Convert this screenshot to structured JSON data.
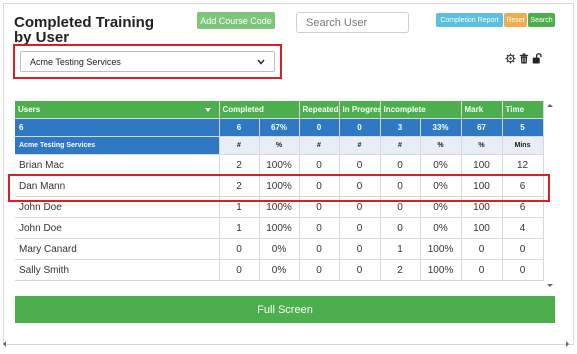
{
  "title": {
    "line1": "Completed Training",
    "line2": "by User"
  },
  "toolbar": {
    "add_course_code": "Add Course Code",
    "completion_report": "Completion Report",
    "reset": "Reset",
    "search": "Search"
  },
  "search": {
    "placeholder": "Search User"
  },
  "select": {
    "value": "Acme Testing Services"
  },
  "icons": [
    "gear-icon",
    "trash-icon",
    "unlock-icon",
    "chevron-down-icon",
    "sort-icon",
    "scroll-up-icon",
    "scroll-down-icon",
    "scroll-left-icon",
    "scroll-right-icon"
  ],
  "colors": {
    "green": "#4cae4c",
    "blue": "#2f78c3",
    "info": "#5bc0de",
    "warning": "#f0ad4e",
    "red_highlight": "#d91f26"
  },
  "table": {
    "headers": [
      "Users",
      "Completed",
      "Repeated",
      "In Progress",
      "Incomplete",
      "Mark",
      "Time"
    ],
    "totals": [
      "6",
      "6",
      "67%",
      "0",
      "0",
      "3",
      "33%",
      "67",
      "5"
    ],
    "group": {
      "name": "Acme Testing Services",
      "units": [
        "#",
        "%",
        "#",
        "#",
        "#",
        "%",
        "%",
        "Mins"
      ]
    },
    "rows": [
      {
        "name": "Brian Mac",
        "cells": [
          "2",
          "100%",
          "0",
          "0",
          "0",
          "0%",
          "100",
          "12"
        ]
      },
      {
        "name": "Dan Mann",
        "cells": [
          "2",
          "100%",
          "0",
          "0",
          "0",
          "0%",
          "100",
          "6"
        ]
      },
      {
        "name": "John Doe",
        "cells": [
          "1",
          "100%",
          "0",
          "0",
          "0",
          "0%",
          "100",
          "6"
        ]
      },
      {
        "name": "John Doe",
        "cells": [
          "1",
          "100%",
          "0",
          "0",
          "0",
          "0%",
          "100",
          "4"
        ]
      },
      {
        "name": "Mary Canard",
        "cells": [
          "0",
          "0%",
          "0",
          "0",
          "1",
          "100%",
          "0",
          "0"
        ]
      },
      {
        "name": "Sally Smith",
        "cells": [
          "0",
          "0%",
          "0",
          "0",
          "2",
          "100%",
          "0",
          "0"
        ]
      }
    ]
  },
  "full_screen": "Full Screen"
}
